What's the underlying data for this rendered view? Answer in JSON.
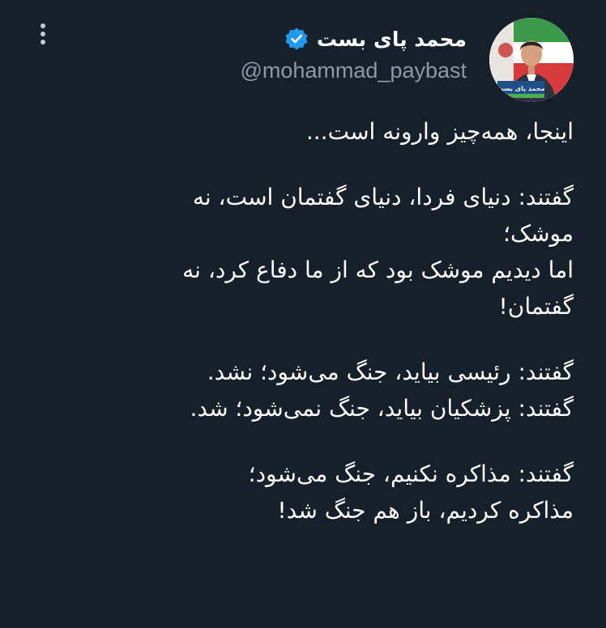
{
  "tweet": {
    "author": {
      "display_name": "محمد پای بست",
      "handle": "@mohammad_paybast",
      "verified": true,
      "avatar_caption": "محمد پای بست",
      "verified_icon": "verified-badge-icon"
    },
    "menu_icon": "more-vertical-icon",
    "body": {
      "intro": "اینجا، همه‌چیز وارونه است...",
      "p1_l1": "گفتند: دنیای فردا، دنیای گفتمان است، نه",
      "p1_l2": "موشک؛",
      "p1_l3": "اما دیدیم موشک بود که از ما دفاع کرد، نه",
      "p1_l4": "گفتمان!",
      "p2_l1": "گفتند: رئیسی بیاید، جنگ می‌شود؛ نشد.",
      "p2_l2": "گفتند: پزشکیان بیاید، جنگ نمی‌شود؛ شد.",
      "p3_l1": "گفتند: مذاکره نکنیم، جنگ می‌شود؛",
      "p3_l2": "مذاکره کردیم، باز هم جنگ شد!"
    },
    "colors": {
      "background": "#15202b",
      "text": "#ffffff",
      "secondary_text": "#8b98a5",
      "verified": "#1d9bf0"
    }
  }
}
